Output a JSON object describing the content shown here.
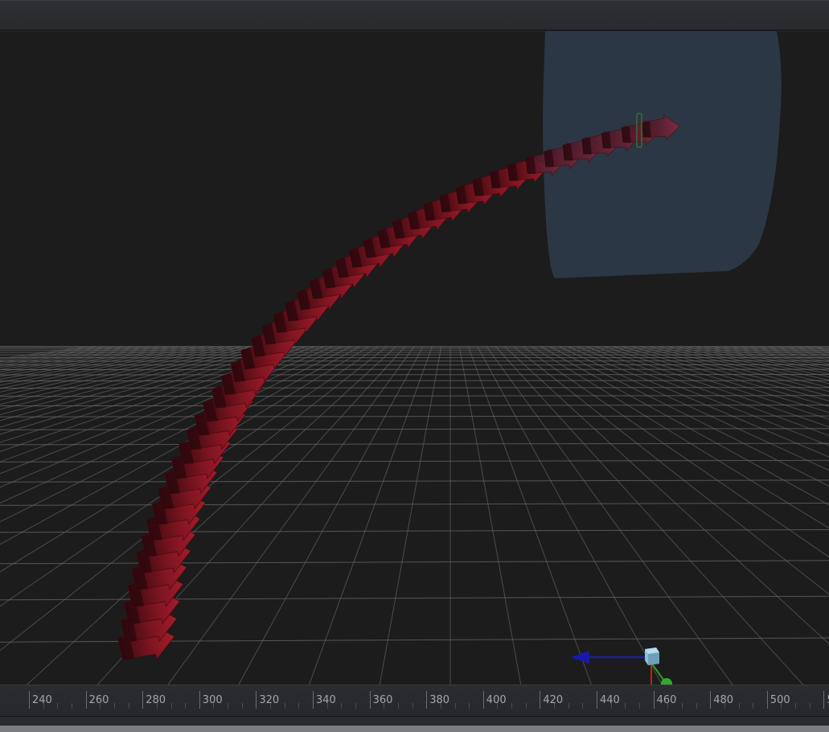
{
  "viewport": {
    "background": "#1c1c1c",
    "grid_color": "#6a6a6a",
    "camera_plane_color": "#2d3a48",
    "arrow_color": "#8a1420",
    "icons": [
      "camera-icon",
      "transform-gizmo-icon",
      "axis-arrow-icon"
    ]
  },
  "ruler": {
    "ticks": [
      "240",
      "260",
      "280",
      "300",
      "320",
      "340",
      "360",
      "380",
      "400",
      "420",
      "440",
      "460",
      "480",
      "500",
      "5"
    ]
  }
}
